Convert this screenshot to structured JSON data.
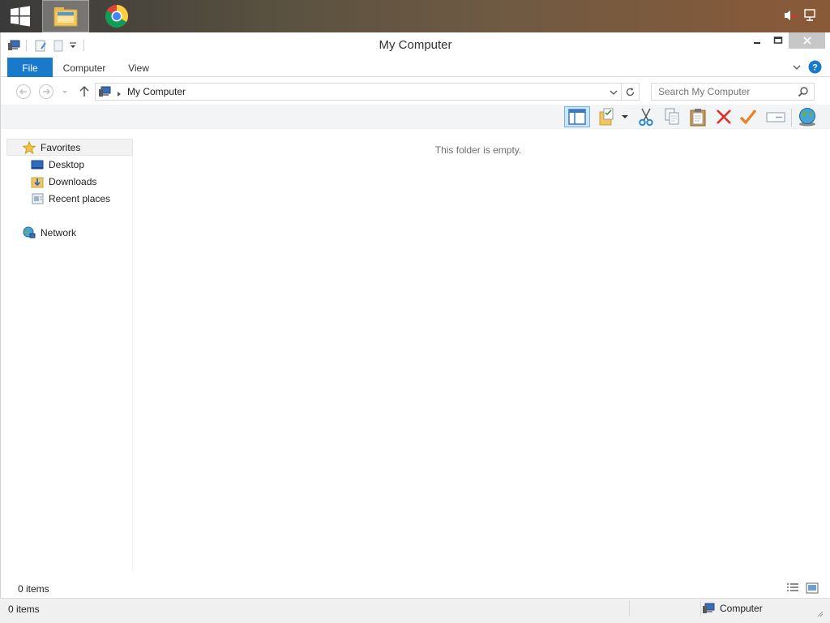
{
  "taskbar": {
    "apps": [
      "Start",
      "File Explorer",
      "Google Chrome"
    ],
    "tray": [
      "volume-muted-icon",
      "network-icon"
    ]
  },
  "window": {
    "title": "My Computer",
    "controls": {
      "minimize": "minimize",
      "maximize": "maximize",
      "close": "close"
    }
  },
  "ribbon": {
    "tabs": [
      {
        "label": "File",
        "active": true
      },
      {
        "label": "Computer",
        "active": false
      },
      {
        "label": "View",
        "active": false
      }
    ],
    "help_icon": "help-icon"
  },
  "address": {
    "path": "My Computer",
    "search_placeholder": "Search My Computer"
  },
  "toolbar": {
    "tools": [
      "preview-pane",
      "folder-options",
      "cut",
      "copy",
      "paste",
      "delete",
      "check",
      "rename",
      "network-globe"
    ]
  },
  "navigation": {
    "favorites": "Favorites",
    "items": [
      "Desktop",
      "Downloads",
      "Recent places"
    ],
    "network": "Network"
  },
  "content": {
    "empty_message": "This folder is empty."
  },
  "status": {
    "item_count": "0 items",
    "bottom_item_count": "0 items",
    "location": "Computer"
  },
  "colors": {
    "accent": "#1979ca",
    "selected_tool_bg": "#cde6f7",
    "close_button": "#c7c7c7"
  }
}
